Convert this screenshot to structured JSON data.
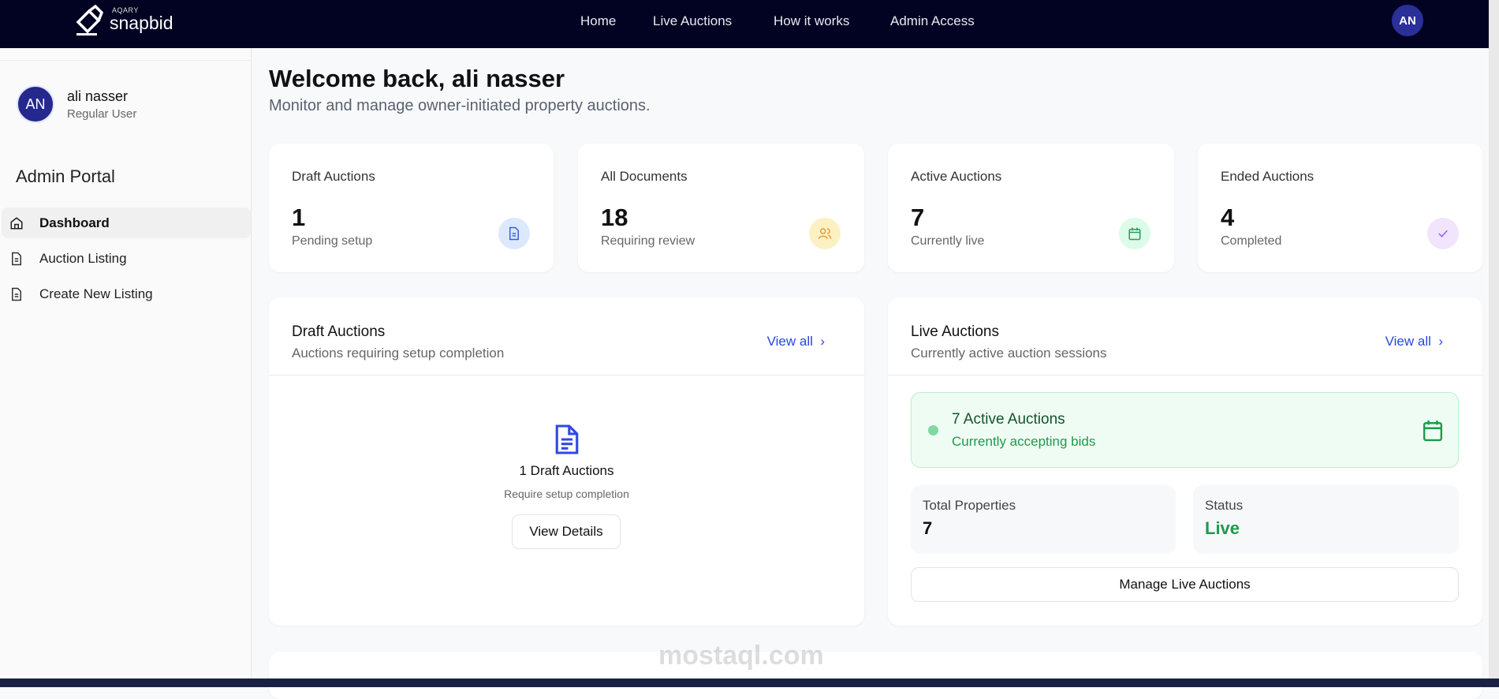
{
  "brand": {
    "top": "AQARY",
    "name": "snapbid"
  },
  "nav": {
    "links": [
      "Home",
      "Live Auctions",
      "How it works",
      "Admin Access"
    ],
    "avatar": "AN"
  },
  "sidebar": {
    "avatar": "AN",
    "name": "ali nasser",
    "role": "Regular User",
    "portal_title": "Admin Portal",
    "items": [
      {
        "label": "Dashboard"
      },
      {
        "label": "Auction Listing"
      },
      {
        "label": "Create New Listing"
      }
    ]
  },
  "header": {
    "title": "Welcome back, ali nasser",
    "subtitle": "Monitor and manage owner-initiated property auctions."
  },
  "stats": [
    {
      "label": "Draft Auctions",
      "value": "1",
      "sub": "Pending setup",
      "icon": "document-icon",
      "bg": "#dbe8fd",
      "fg": "#3b5ce6"
    },
    {
      "label": "All Documents",
      "value": "18",
      "sub": "Requiring review",
      "icon": "users-icon",
      "bg": "#fdf1c4",
      "fg": "#e49a3a"
    },
    {
      "label": "Active Auctions",
      "value": "7",
      "sub": "Currently live",
      "icon": "calendar-icon",
      "bg": "#dcfbe8",
      "fg": "#23a05a"
    },
    {
      "label": "Ended Auctions",
      "value": "4",
      "sub": "Completed",
      "icon": "check-icon",
      "bg": "#f1e4fd",
      "fg": "#9b5de5"
    }
  ],
  "draft": {
    "title": "Draft Auctions",
    "subtitle": "Auctions requiring setup completion",
    "view_all": "View all",
    "count_label": "1 Draft Auctions",
    "note": "Require setup completion",
    "button": "View Details"
  },
  "live": {
    "title": "Live Auctions",
    "subtitle": "Currently active auction sessions",
    "view_all": "View all",
    "banner_title": "7 Active Auctions",
    "banner_sub": "Currently accepting bids",
    "total_label": "Total Properties",
    "total_value": "7",
    "status_label": "Status",
    "status_value": "Live",
    "button": "Manage Live Auctions"
  },
  "watermark": "mostaql.com"
}
